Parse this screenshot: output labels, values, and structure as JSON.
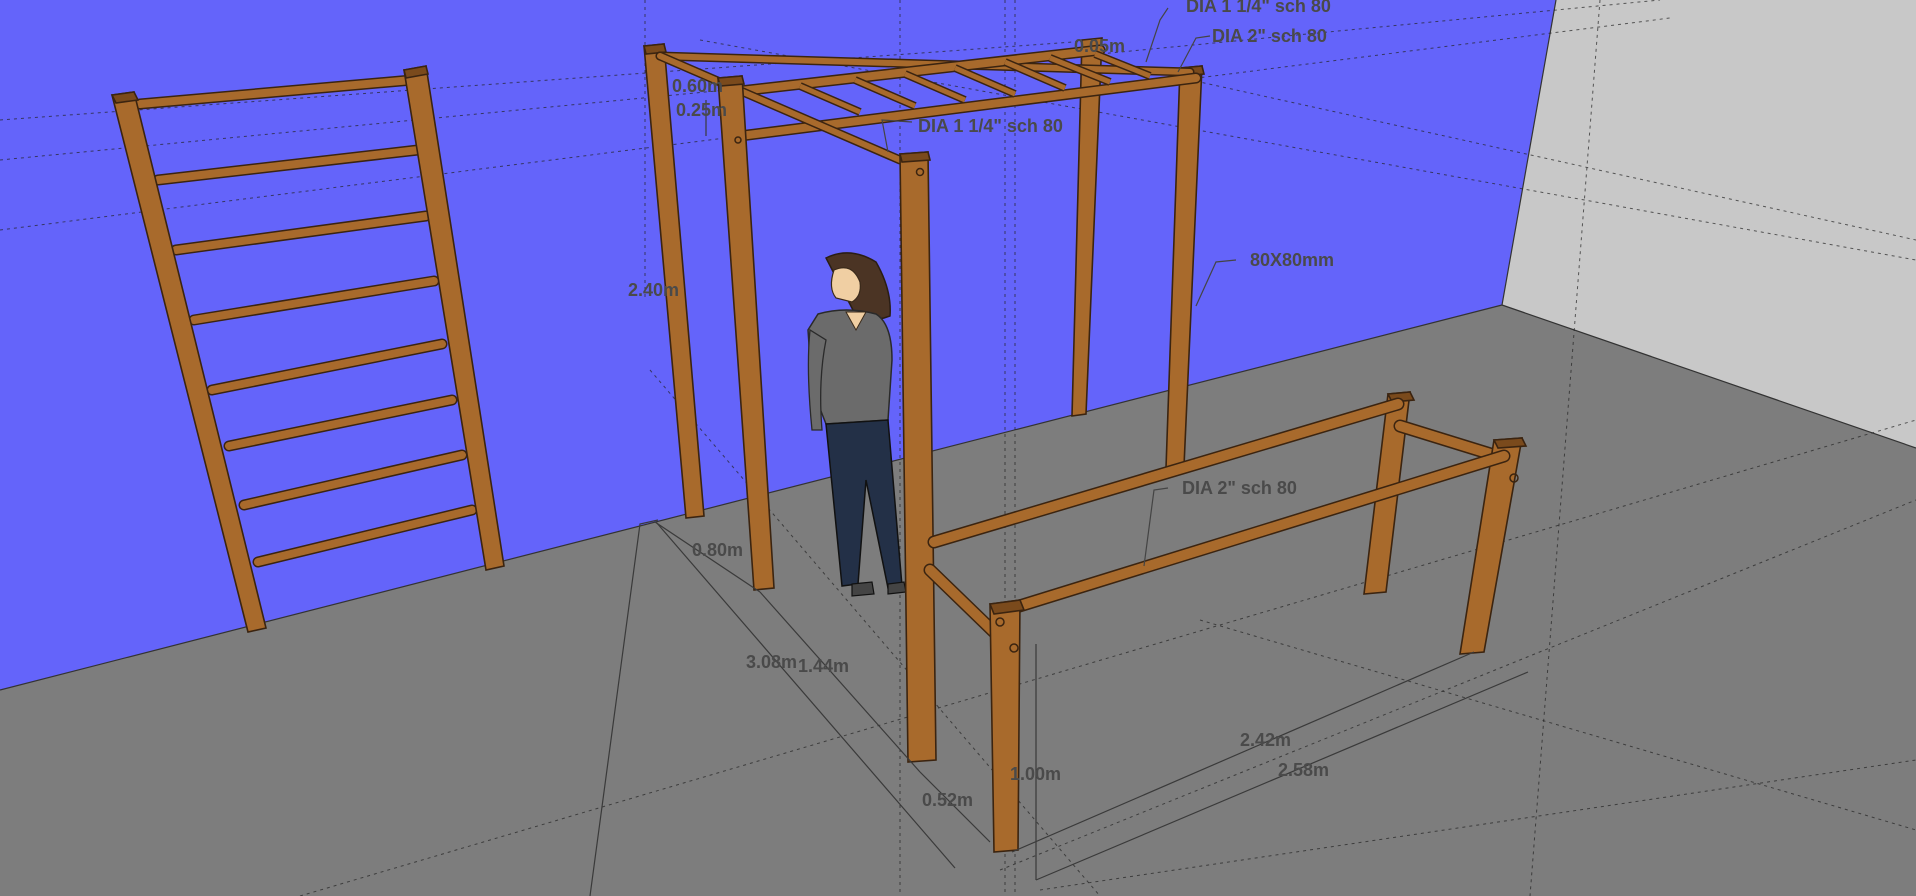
{
  "scene": {
    "wall_color": "#6464fa",
    "floor_color": "#7d7d7d",
    "side_wall_color": "#c8c8c8",
    "wood_color": "#a86a2c",
    "wood_outline": "#3b2410"
  },
  "labels": {
    "monkey_bar_rung": "DIA 1 1/4\" sch 80",
    "top_rail": "DIA 2\" sch 80",
    "inner_rail": "DIA 1 1/4\" sch 80",
    "post_size": "80X80mm",
    "parallel_bar_rail": "DIA 2\" sch 80"
  },
  "dimensions": {
    "rung_spacing_a": "0.60m",
    "rung_spacing_b": "0.25m",
    "top_offset": "0.05m",
    "height": "2.40m",
    "depth_frame": "0.80m",
    "total_length": "3.08m",
    "inner_length": "1.44m",
    "gap": "0.52m",
    "bar_height": "1.00m",
    "bar_length_inner": "2.42m",
    "bar_length_outer": "2.58m"
  }
}
